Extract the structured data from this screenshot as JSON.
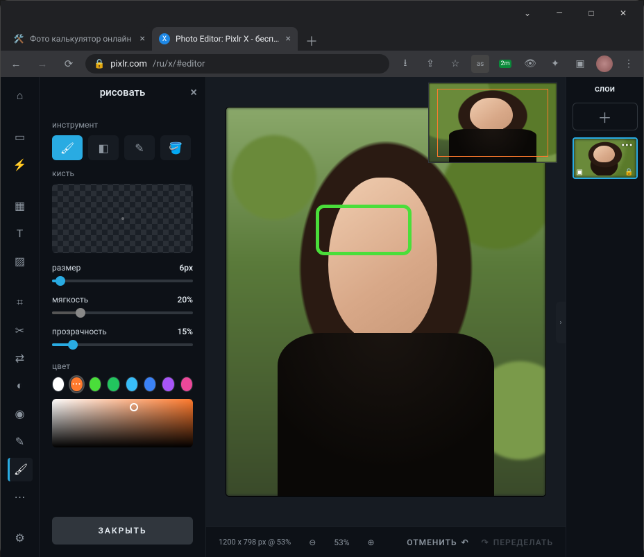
{
  "window": {
    "min": "—",
    "max": "□",
    "close": "✕"
  },
  "tabs": [
    {
      "favicon": "🛠️",
      "title": "Фото калькулятор онлайн",
      "active": false
    },
    {
      "favicon": "✖️",
      "title": "Photo Editor: Pixlr X - бесплатны",
      "active": true
    }
  ],
  "newtab": "＋",
  "url": {
    "lock": "🔒",
    "domain": "pixlr.com",
    "path": "/ru/x/#editor"
  },
  "url_actions": {
    "install": "⭳",
    "share": "⇪",
    "star": "☆"
  },
  "extensions": {
    "as": "as",
    "badge": "2m",
    "eye": "👁",
    "puzzle": "✦",
    "window": "▣",
    "avatar": "●",
    "menu": "⋮"
  },
  "rail": [
    {
      "name": "home",
      "glyph": "⌂"
    },
    {
      "name": "spacer"
    },
    {
      "name": "select",
      "glyph": "▭"
    },
    {
      "name": "wand",
      "glyph": "⚡"
    },
    {
      "name": "spacer"
    },
    {
      "name": "layout",
      "glyph": "▦"
    },
    {
      "name": "text",
      "glyph": "T"
    },
    {
      "name": "pattern",
      "glyph": "▨"
    },
    {
      "name": "spacer"
    },
    {
      "name": "crop",
      "glyph": "⌗"
    },
    {
      "name": "cut",
      "glyph": "✂"
    },
    {
      "name": "adjust",
      "glyph": "⇄"
    },
    {
      "name": "contrast",
      "glyph": "◐"
    },
    {
      "name": "liquify",
      "glyph": "◉"
    },
    {
      "name": "heal",
      "glyph": "✎"
    },
    {
      "name": "draw",
      "glyph": "🖌",
      "active": true
    },
    {
      "name": "more",
      "glyph": "⋯"
    },
    {
      "name": "spacer"
    },
    {
      "name": "settings",
      "glyph": "⚙"
    }
  ],
  "panel": {
    "title": "рисовать",
    "labels": {
      "tool": "инструмент",
      "brush": "кисть",
      "size": "размер",
      "soft": "мягкость",
      "opacity": "прозрачность",
      "color": "цвет"
    },
    "tools": [
      {
        "name": "brush",
        "active": true,
        "glyph": "🖌"
      },
      {
        "name": "eraser",
        "glyph": "◧"
      },
      {
        "name": "pencil",
        "glyph": "✎"
      },
      {
        "name": "fill",
        "glyph": "🪣"
      }
    ],
    "size": {
      "value": "6px",
      "pct": 6
    },
    "soft": {
      "value": "20%",
      "pct": 20
    },
    "opacity": {
      "value": "15%",
      "pct": 15
    },
    "colors": [
      "#ffffff",
      "#ff7a2d",
      "#4ade3a",
      "#22c55e",
      "#38bdf8",
      "#3b82f6",
      "#a855f7",
      "#ec4899"
    ],
    "close_btn": "ЗАКРЫТЬ"
  },
  "canvas": {
    "info": "1200 x 798 px @ 53%",
    "zoom": "53%",
    "undo": "ОТМЕНИТЬ",
    "redo": "ПЕРЕДЕЛАТЬ"
  },
  "layers": {
    "title": "слои",
    "add": "＋"
  }
}
